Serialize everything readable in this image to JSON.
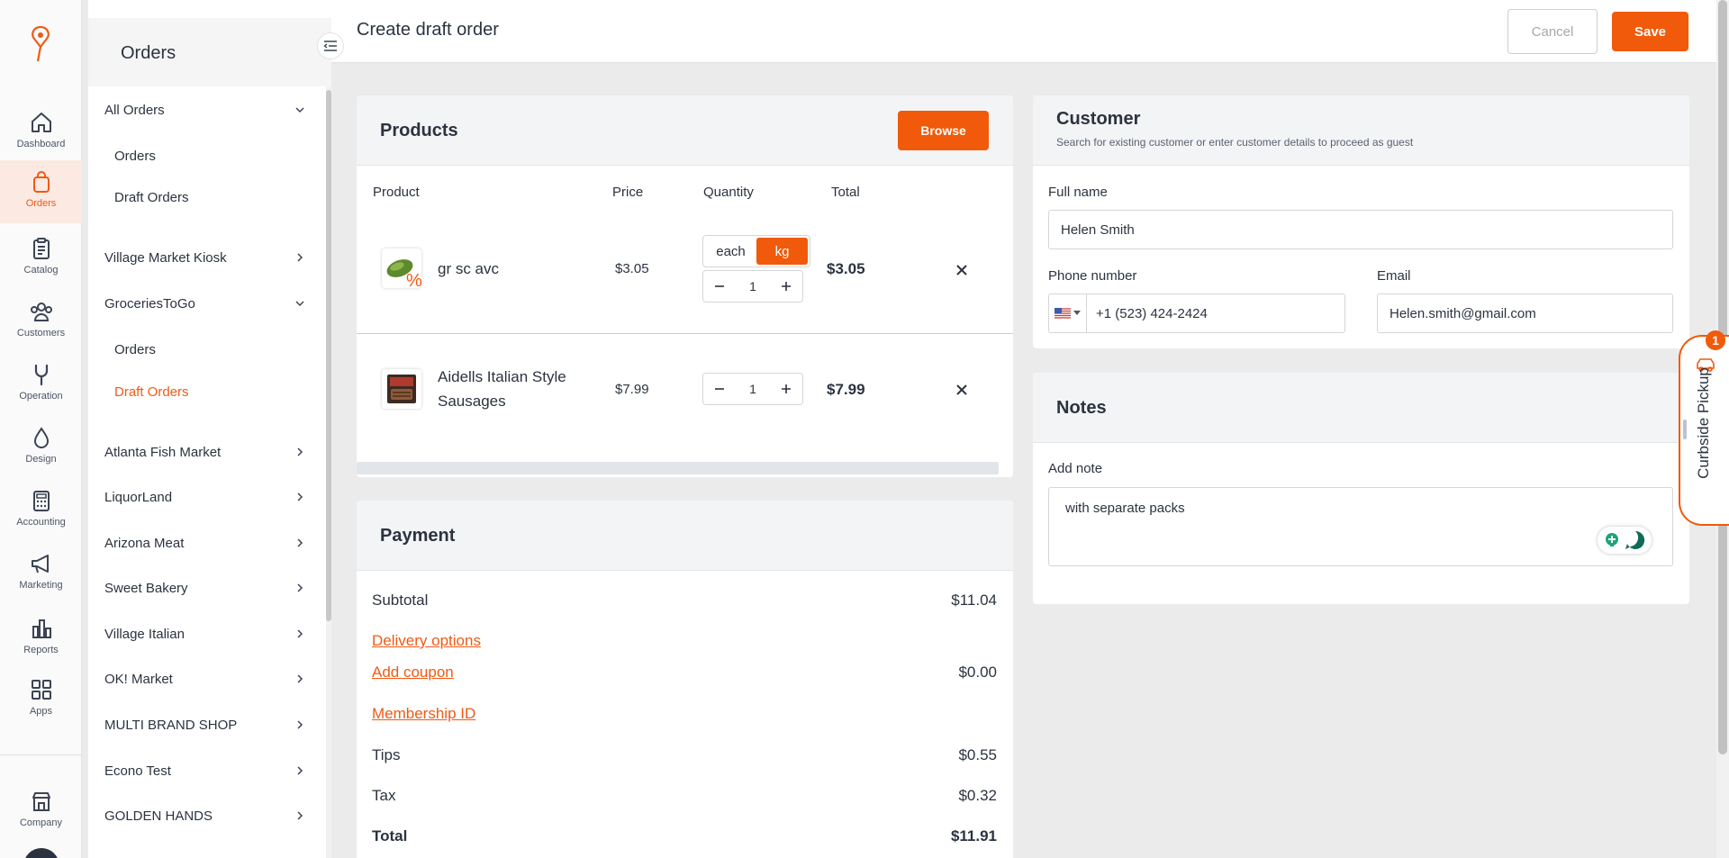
{
  "rail": {
    "items": [
      {
        "label": "Dashboard",
        "icon": "home-icon"
      },
      {
        "label": "Orders",
        "icon": "shopping-bag-icon",
        "active": true
      },
      {
        "label": "Catalog",
        "icon": "clipboard-icon"
      },
      {
        "label": "Customers",
        "icon": "users-icon"
      },
      {
        "label": "Operation",
        "icon": "wrench-icon"
      },
      {
        "label": "Design",
        "icon": "droplet-icon"
      },
      {
        "label": "Accounting",
        "icon": "calculator-icon"
      },
      {
        "label": "Marketing",
        "icon": "megaphone-icon"
      },
      {
        "label": "Reports",
        "icon": "bar-chart-icon"
      },
      {
        "label": "Apps",
        "icon": "grid-icon"
      },
      {
        "label": "Company",
        "icon": "store-icon"
      }
    ],
    "accent": "#f05a14"
  },
  "sidebar": {
    "title": "Orders",
    "all_orders": {
      "label": "All Orders",
      "sub": [
        "Orders",
        "Draft Orders"
      ]
    },
    "village_market": "Village Market Kiosk",
    "groceries": {
      "label": "GroceriesToGo",
      "sub": [
        "Orders",
        "Draft Orders"
      ]
    },
    "stores": [
      "Atlanta Fish Market",
      "LiquorLand",
      "Arizona Meat",
      "Sweet Bakery",
      "Village Italian",
      "OK! Market",
      "MULTI BRAND SHOP",
      "Econo Test",
      "GOLDEN HANDS"
    ]
  },
  "header": {
    "title": "Create draft order",
    "cancel": "Cancel",
    "save": "Save"
  },
  "products": {
    "title": "Products",
    "browse": "Browse",
    "columns": {
      "product": "Product",
      "price": "Price",
      "quantity": "Quantity",
      "total": "Total"
    },
    "items": [
      {
        "name": "gr sc avc",
        "price": "$3.05",
        "units": [
          "each",
          "kg"
        ],
        "selected_unit": "kg",
        "qty": "1",
        "total": "$3.05"
      },
      {
        "name": "Aidells Italian Style Sausages",
        "price": "$7.99",
        "qty": "1",
        "total": "$7.99"
      }
    ]
  },
  "payment": {
    "title": "Payment",
    "subtotal_label": "Subtotal",
    "subtotal": "$11.04",
    "delivery": "Delivery options",
    "coupon": "Add coupon",
    "coupon_value": "$0.00",
    "membership": "Membership ID",
    "tips_label": "Tips",
    "tips": "$0.55",
    "tax_label": "Tax",
    "tax": "$0.32",
    "total_label": "Total",
    "total": "$11.91"
  },
  "customer": {
    "title": "Customer",
    "subtitle": "Search for existing customer or enter customer details to proceed as guest",
    "full_name_label": "Full name",
    "full_name": "Helen Smith",
    "phone_label": "Phone number",
    "phone": "+1 (523) 424-2424",
    "email_label": "Email",
    "email": "Helen.smith@gmail.com"
  },
  "notes": {
    "title": "Notes",
    "add_label": "Add note",
    "text": "with separate packs"
  },
  "curbside": {
    "label": "Curbside Pickup",
    "badge": "1"
  }
}
